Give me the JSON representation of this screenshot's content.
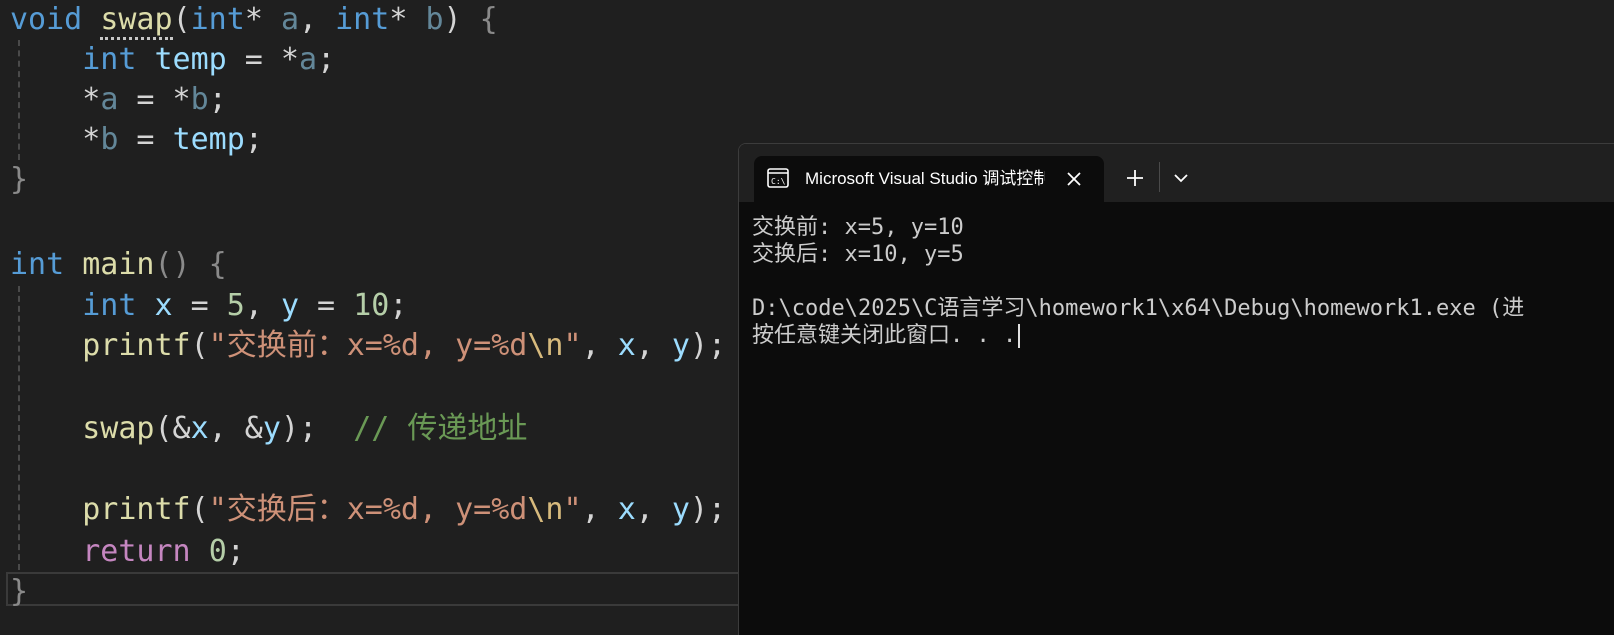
{
  "editor": {
    "lines": [
      {
        "tokens": [
          [
            "kw",
            "void"
          ],
          [
            "punct",
            " "
          ],
          [
            "fn squiggle",
            "swap"
          ],
          [
            "punct",
            "("
          ],
          [
            "kw",
            "int"
          ],
          [
            "punct",
            "* "
          ],
          [
            "param",
            "a"
          ],
          [
            "punct",
            ", "
          ],
          [
            "kw",
            "int"
          ],
          [
            "punct",
            "* "
          ],
          [
            "param",
            "b"
          ],
          [
            "punct",
            ") "
          ],
          [
            "brace-dim",
            "{"
          ]
        ]
      },
      {
        "tokens": [
          [
            "punct",
            "    "
          ],
          [
            "kw",
            "int"
          ],
          [
            "punct",
            " "
          ],
          [
            "var",
            "temp"
          ],
          [
            "punct",
            " = *"
          ],
          [
            "param",
            "a"
          ],
          [
            "punct",
            ";"
          ]
        ]
      },
      {
        "tokens": [
          [
            "punct",
            "    *"
          ],
          [
            "param",
            "a"
          ],
          [
            "punct",
            " = *"
          ],
          [
            "param",
            "b"
          ],
          [
            "punct",
            ";"
          ]
        ]
      },
      {
        "tokens": [
          [
            "punct",
            "    *"
          ],
          [
            "param",
            "b"
          ],
          [
            "punct",
            " = "
          ],
          [
            "var",
            "temp"
          ],
          [
            "punct",
            ";"
          ]
        ]
      },
      {
        "tokens": [
          [
            "brace-dim",
            "}"
          ]
        ]
      },
      {
        "tokens": []
      },
      {
        "tokens": [
          [
            "kw",
            "int"
          ],
          [
            "punct",
            " "
          ],
          [
            "fn",
            "main"
          ],
          [
            "brace-dim",
            "() {"
          ]
        ]
      },
      {
        "tokens": [
          [
            "punct",
            "    "
          ],
          [
            "kw",
            "int"
          ],
          [
            "punct",
            " "
          ],
          [
            "var",
            "x"
          ],
          [
            "punct",
            " = "
          ],
          [
            "num",
            "5"
          ],
          [
            "punct",
            ", "
          ],
          [
            "var",
            "y"
          ],
          [
            "punct",
            " = "
          ],
          [
            "num",
            "10"
          ],
          [
            "punct",
            ";"
          ]
        ]
      },
      {
        "tokens": [
          [
            "punct",
            "    "
          ],
          [
            "fn",
            "printf"
          ],
          [
            "punct",
            "("
          ],
          [
            "str",
            "\"交换前：x=%d, y=%d"
          ],
          [
            "esc",
            "\\n"
          ],
          [
            "str",
            "\""
          ],
          [
            "punct",
            ", "
          ],
          [
            "var",
            "x"
          ],
          [
            "punct",
            ", "
          ],
          [
            "var",
            "y"
          ],
          [
            "punct",
            ");"
          ]
        ]
      },
      {
        "tokens": []
      },
      {
        "tokens": [
          [
            "punct",
            "    "
          ],
          [
            "fn",
            "swap"
          ],
          [
            "punct",
            "(&"
          ],
          [
            "var",
            "x"
          ],
          [
            "punct",
            ", &"
          ],
          [
            "var",
            "y"
          ],
          [
            "punct",
            ");  "
          ],
          [
            "cmt",
            "// 传递地址"
          ]
        ]
      },
      {
        "tokens": []
      },
      {
        "tokens": [
          [
            "punct",
            "    "
          ],
          [
            "fn",
            "printf"
          ],
          [
            "punct",
            "("
          ],
          [
            "str",
            "\"交换后：x=%d, y=%d"
          ],
          [
            "esc",
            "\\n"
          ],
          [
            "str",
            "\""
          ],
          [
            "punct",
            ", "
          ],
          [
            "var",
            "x"
          ],
          [
            "punct",
            ", "
          ],
          [
            "var",
            "y"
          ],
          [
            "punct",
            ");"
          ]
        ]
      },
      {
        "tokens": [
          [
            "punct",
            "    "
          ],
          [
            "kw-ctrl",
            "return"
          ],
          [
            "punct",
            " "
          ],
          [
            "num",
            "0"
          ],
          [
            "punct",
            ";"
          ]
        ]
      },
      {
        "tokens": [
          [
            "brace-dim",
            "}"
          ]
        ]
      }
    ]
  },
  "terminal": {
    "tab_title": "Microsoft Visual Studio 调试控制台",
    "icon": "console-icon",
    "close_icon": "close-icon",
    "new_tab_icon": "plus-icon",
    "dropdown_icon": "chevron-down-icon",
    "output_lines": [
      "交换前: x=5, y=10",
      "交换后: x=10, y=5",
      "",
      "D:\\code\\2025\\C语言学习\\homework1\\x64\\Debug\\homework1.exe (进",
      "按任意键关闭此窗口. . ."
    ]
  },
  "colors": {
    "editor_bg": "#1f1f1f",
    "terminal_bg": "#0c0c0c",
    "keyword": "#569cd6",
    "function": "#dcdcaa",
    "string": "#ce9178",
    "comment": "#6a9955"
  }
}
